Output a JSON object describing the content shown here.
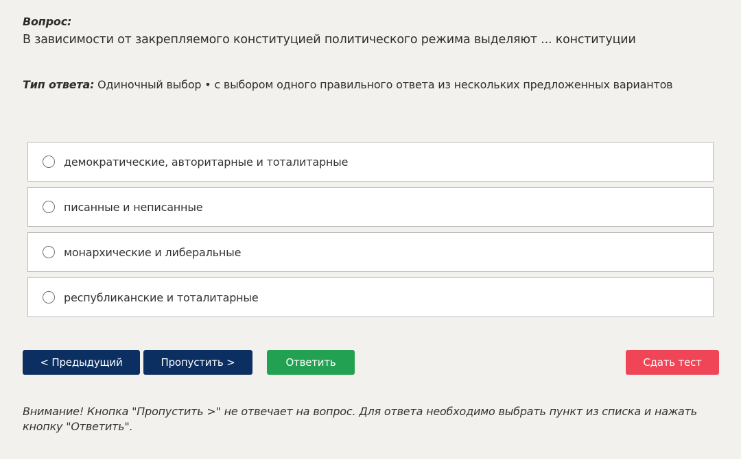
{
  "question": {
    "label": "Вопрос:",
    "text": "В зависимости от закрепляемого конституцией политического режима выделяют ... конституции"
  },
  "answer_type": {
    "label": "Тип ответа:",
    "value": "Одиночный выбор • с выбором одного правильного ответа из нескольких предложенных вариантов"
  },
  "options": [
    {
      "label": "демократические, авторитарные и тоталитарные",
      "selected": false
    },
    {
      "label": "писанные и неписанные",
      "selected": false
    },
    {
      "label": "монархические и либеральные",
      "selected": false
    },
    {
      "label": "республиканские и тоталитарные",
      "selected": false
    }
  ],
  "buttons": {
    "prev": "< Предыдущий",
    "skip": "Пропустить >",
    "answer": "Ответить",
    "finish": "Сдать тест"
  },
  "notice": "Внимание! Кнопка \"Пропустить >\" не отвечает на вопрос. Для ответа необходимо выбрать пункт из списка и нажать кнопку \"Ответить\".",
  "colors": {
    "background": "#f2f1ee",
    "nav_button": "#0b2f61",
    "answer_button": "#23a153",
    "finish_button": "#f04457"
  }
}
